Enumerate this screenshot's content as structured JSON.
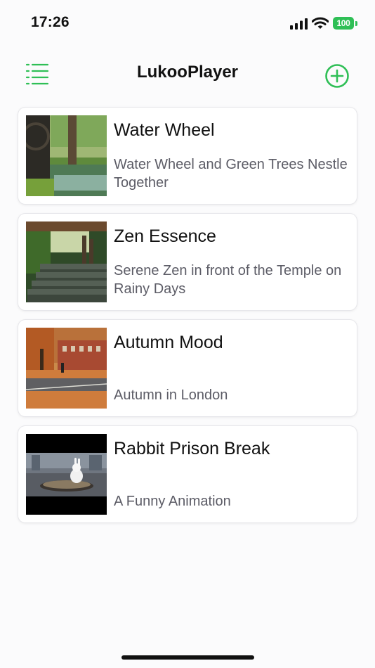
{
  "status_bar": {
    "time": "17:26",
    "battery": "100",
    "signal_icon": "cellular-signal-icon",
    "wifi_icon": "wifi-icon"
  },
  "header": {
    "title": "LukooPlayer",
    "menu_icon": "list-menu-icon",
    "add_icon": "plus-circle-icon",
    "accent_color": "#2fbf56"
  },
  "videos": [
    {
      "title": "Water Wheel",
      "subtitle": "Water Wheel and Green Trees Nestle Together"
    },
    {
      "title": "Zen Essence",
      "subtitle": "Serene Zen in front of the Temple on Rainy Days"
    },
    {
      "title": "Autumn Mood",
      "subtitle": "Autumn in London"
    },
    {
      "title": "Rabbit Prison Break",
      "subtitle": "A Funny Animation"
    }
  ]
}
